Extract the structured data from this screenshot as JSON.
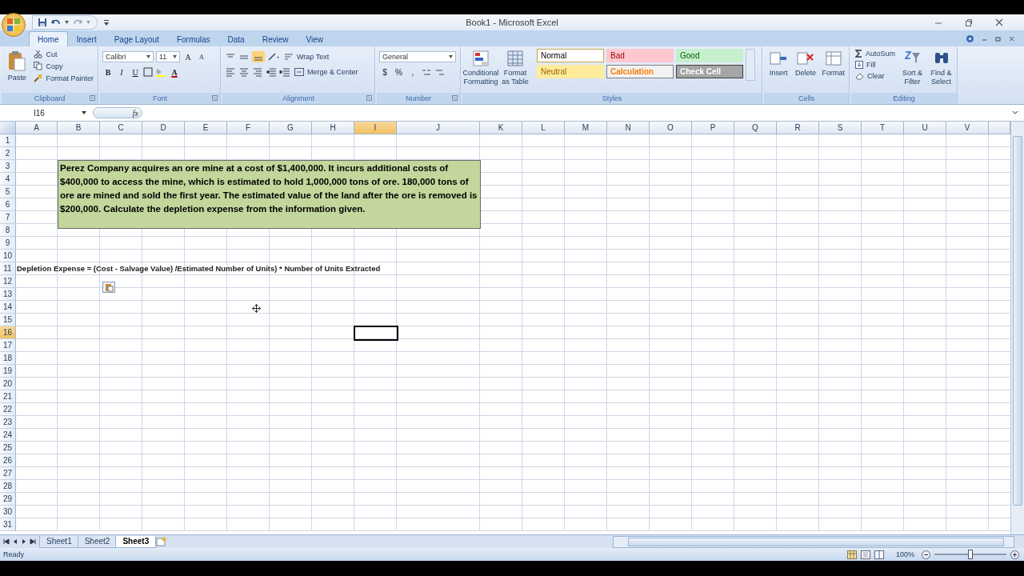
{
  "window": {
    "title": "Book1 - Microsoft Excel"
  },
  "tabs": [
    {
      "label": "Home",
      "selected": true
    },
    {
      "label": "Insert",
      "selected": false
    },
    {
      "label": "Page Layout",
      "selected": false
    },
    {
      "label": "Formulas",
      "selected": false
    },
    {
      "label": "Data",
      "selected": false
    },
    {
      "label": "Review",
      "selected": false
    },
    {
      "label": "View",
      "selected": false
    }
  ],
  "clipboard": {
    "paste": "Paste",
    "cut": "Cut",
    "copy": "Copy",
    "format_painter": "Format Painter",
    "label": "Clipboard"
  },
  "font": {
    "name": "Calibri",
    "size": "11",
    "grow": "A",
    "shrink": "A",
    "bold": "B",
    "italic": "I",
    "underline": "U",
    "font_color": "A",
    "label": "Font"
  },
  "alignment": {
    "wrap_text": "Wrap Text",
    "merge_center": "Merge & Center",
    "label": "Alignment"
  },
  "number": {
    "format": "General",
    "currency": "$",
    "percent": "%",
    "comma": ",",
    "label": "Number"
  },
  "styles": {
    "conditional": "Conditional Formatting",
    "table": "Format as Table",
    "label": "Styles",
    "cells": [
      {
        "label": "Normal",
        "kind": "normal"
      },
      {
        "label": "Bad",
        "kind": "bad"
      },
      {
        "label": "Good",
        "kind": "good"
      },
      {
        "label": "Neutral",
        "kind": "neutral"
      },
      {
        "label": "Calculation",
        "kind": "calculation"
      },
      {
        "label": "Check Cell",
        "kind": "check"
      }
    ]
  },
  "cells_group": {
    "insert": "Insert",
    "delete": "Delete",
    "format": "Format",
    "label": "Cells"
  },
  "editing": {
    "autosum": "AutoSum",
    "fill": "Fill",
    "clear": "Clear",
    "sort": "Sort & Filter",
    "find": "Find & Select",
    "label": "Editing"
  },
  "formula_bar": {
    "name_box": "I16",
    "fx": "fx"
  },
  "columns": [
    {
      "label": "A",
      "selected": false
    },
    {
      "label": "B",
      "selected": false
    },
    {
      "label": "C",
      "selected": false
    },
    {
      "label": "D",
      "selected": false
    },
    {
      "label": "E",
      "selected": false
    },
    {
      "label": "F",
      "selected": false
    },
    {
      "label": "G",
      "selected": false
    },
    {
      "label": "H",
      "selected": false
    },
    {
      "label": "I",
      "selected": true
    },
    {
      "label": "J",
      "selected": false
    },
    {
      "label": "K",
      "selected": false
    },
    {
      "label": "L",
      "selected": false
    },
    {
      "label": "M",
      "selected": false
    },
    {
      "label": "N",
      "selected": false
    },
    {
      "label": "O",
      "selected": false
    },
    {
      "label": "P",
      "selected": false
    },
    {
      "label": "Q",
      "selected": false
    },
    {
      "label": "R",
      "selected": false
    },
    {
      "label": "S",
      "selected": false
    },
    {
      "label": "T",
      "selected": false
    },
    {
      "label": "U",
      "selected": false
    },
    {
      "label": "V",
      "selected": false
    }
  ],
  "rows": [
    {
      "label": "1",
      "selected": false
    },
    {
      "label": "2",
      "selected": false
    },
    {
      "label": "3",
      "selected": false
    },
    {
      "label": "4",
      "selected": false
    },
    {
      "label": "5",
      "selected": false
    },
    {
      "label": "6",
      "selected": false
    },
    {
      "label": "7",
      "selected": false
    },
    {
      "label": "8",
      "selected": false
    },
    {
      "label": "9",
      "selected": false
    },
    {
      "label": "10",
      "selected": false
    },
    {
      "label": "11",
      "selected": false,
      "text": "Depletion Expense = (Cost - Salvage Value) /Estimated Number of Units) * Number of Units Extracted"
    },
    {
      "label": "12",
      "selected": false
    },
    {
      "label": "13",
      "selected": false
    },
    {
      "label": "14",
      "selected": false
    },
    {
      "label": "15",
      "selected": false
    },
    {
      "label": "16",
      "selected": true
    },
    {
      "label": "17",
      "selected": false
    },
    {
      "label": "18",
      "selected": false
    },
    {
      "label": "19",
      "selected": false
    },
    {
      "label": "20",
      "selected": false
    },
    {
      "label": "21",
      "selected": false
    },
    {
      "label": "22",
      "selected": false
    },
    {
      "label": "23",
      "selected": false
    },
    {
      "label": "24",
      "selected": false
    },
    {
      "label": "25",
      "selected": false
    },
    {
      "label": "26",
      "selected": false
    },
    {
      "label": "27",
      "selected": false
    },
    {
      "label": "28",
      "selected": false
    },
    {
      "label": "29",
      "selected": false
    },
    {
      "label": "30",
      "selected": false
    },
    {
      "label": "31",
      "selected": false
    }
  ],
  "text_box": {
    "text": "Perez Company acquires an ore mine at a cost of $1,400,000. It incurs additional costs of $400,000 to access the mine, which is estimated to hold 1,000,000 tons of ore. 180,000 tons of ore are mined and sold the first year. The estimated value of the land after the ore is removed is $200,000. Calculate the depletion expense from the information given."
  },
  "sheet_tabs": [
    {
      "label": "Sheet1",
      "selected": false
    },
    {
      "label": "Sheet2",
      "selected": false
    },
    {
      "label": "Sheet3",
      "selected": true
    }
  ],
  "status_bar": {
    "text": "Ready",
    "zoom": "100%",
    "zoom_slider": {
      "level": 0.5
    }
  }
}
